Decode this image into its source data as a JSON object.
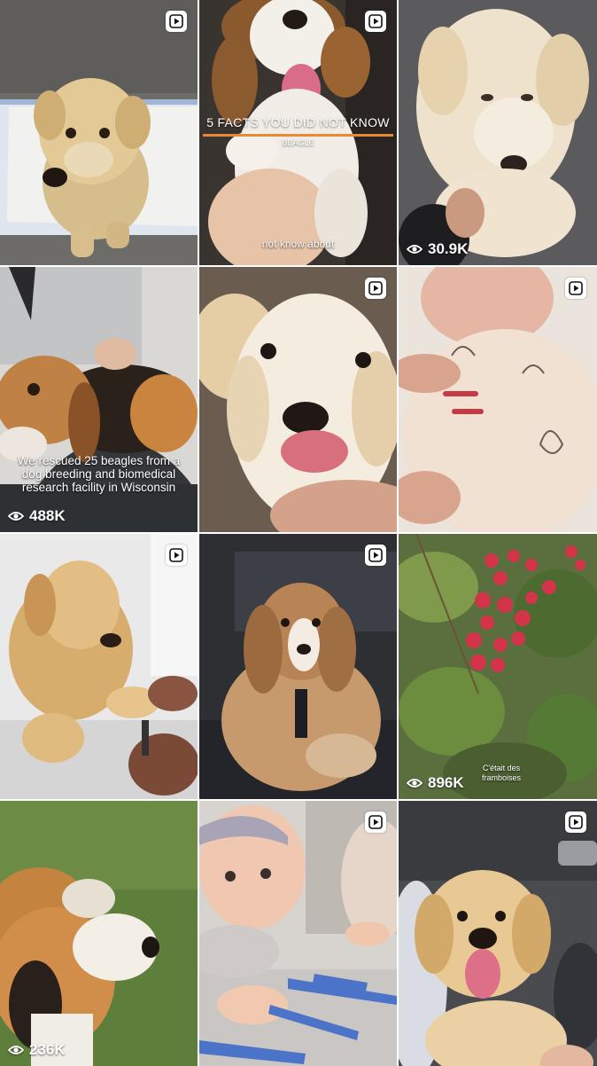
{
  "tiles": [
    {
      "subject": "golden-retriever-puppy-on-pad",
      "views": "",
      "has_play_icon": true
    },
    {
      "subject": "beagle-puppy-belly-up",
      "views": "",
      "has_play_icon": true,
      "overlay_title": "5 FACTS YOU DID NOT KNOW",
      "overlay_subtitle": "BEAGLE",
      "overlay_caption": "not know about"
    },
    {
      "subject": "golden-retriever-puppy-held",
      "views": "30.9K",
      "has_play_icon": false
    },
    {
      "subject": "beagle-being-petted",
      "views": "488K",
      "has_play_icon": false,
      "overlay_text": "We rescued 25 beagles from a dog breeding and biomedical research facility in Wisconsin"
    },
    {
      "subject": "golden-retriever-puppy-tongue",
      "views": "",
      "has_play_icon": true
    },
    {
      "subject": "baby-in-bunny-shirt",
      "views": "",
      "has_play_icon": true
    },
    {
      "subject": "golden-retriever-nail-trim",
      "views": "",
      "has_play_icon": true
    },
    {
      "subject": "cocker-spaniel-puppy-in-car",
      "views": "",
      "has_play_icon": true
    },
    {
      "subject": "raspberry-bush",
      "views": "896K",
      "has_play_icon": false,
      "overlay_text": "C'était des framboises"
    },
    {
      "subject": "beagle-on-grass",
      "views": "236K",
      "has_play_icon": false
    },
    {
      "subject": "baby-with-blue-tape",
      "views": "",
      "has_play_icon": true
    },
    {
      "subject": "golden-retriever-puppy-in-car",
      "views": "",
      "has_play_icon": true
    }
  ],
  "icons": {
    "play": "play-reel-icon",
    "views": "eye-icon"
  },
  "colors": {
    "background": "#ffffff",
    "overlay_text": "#ffffff",
    "accent_line": "#e88a35"
  }
}
